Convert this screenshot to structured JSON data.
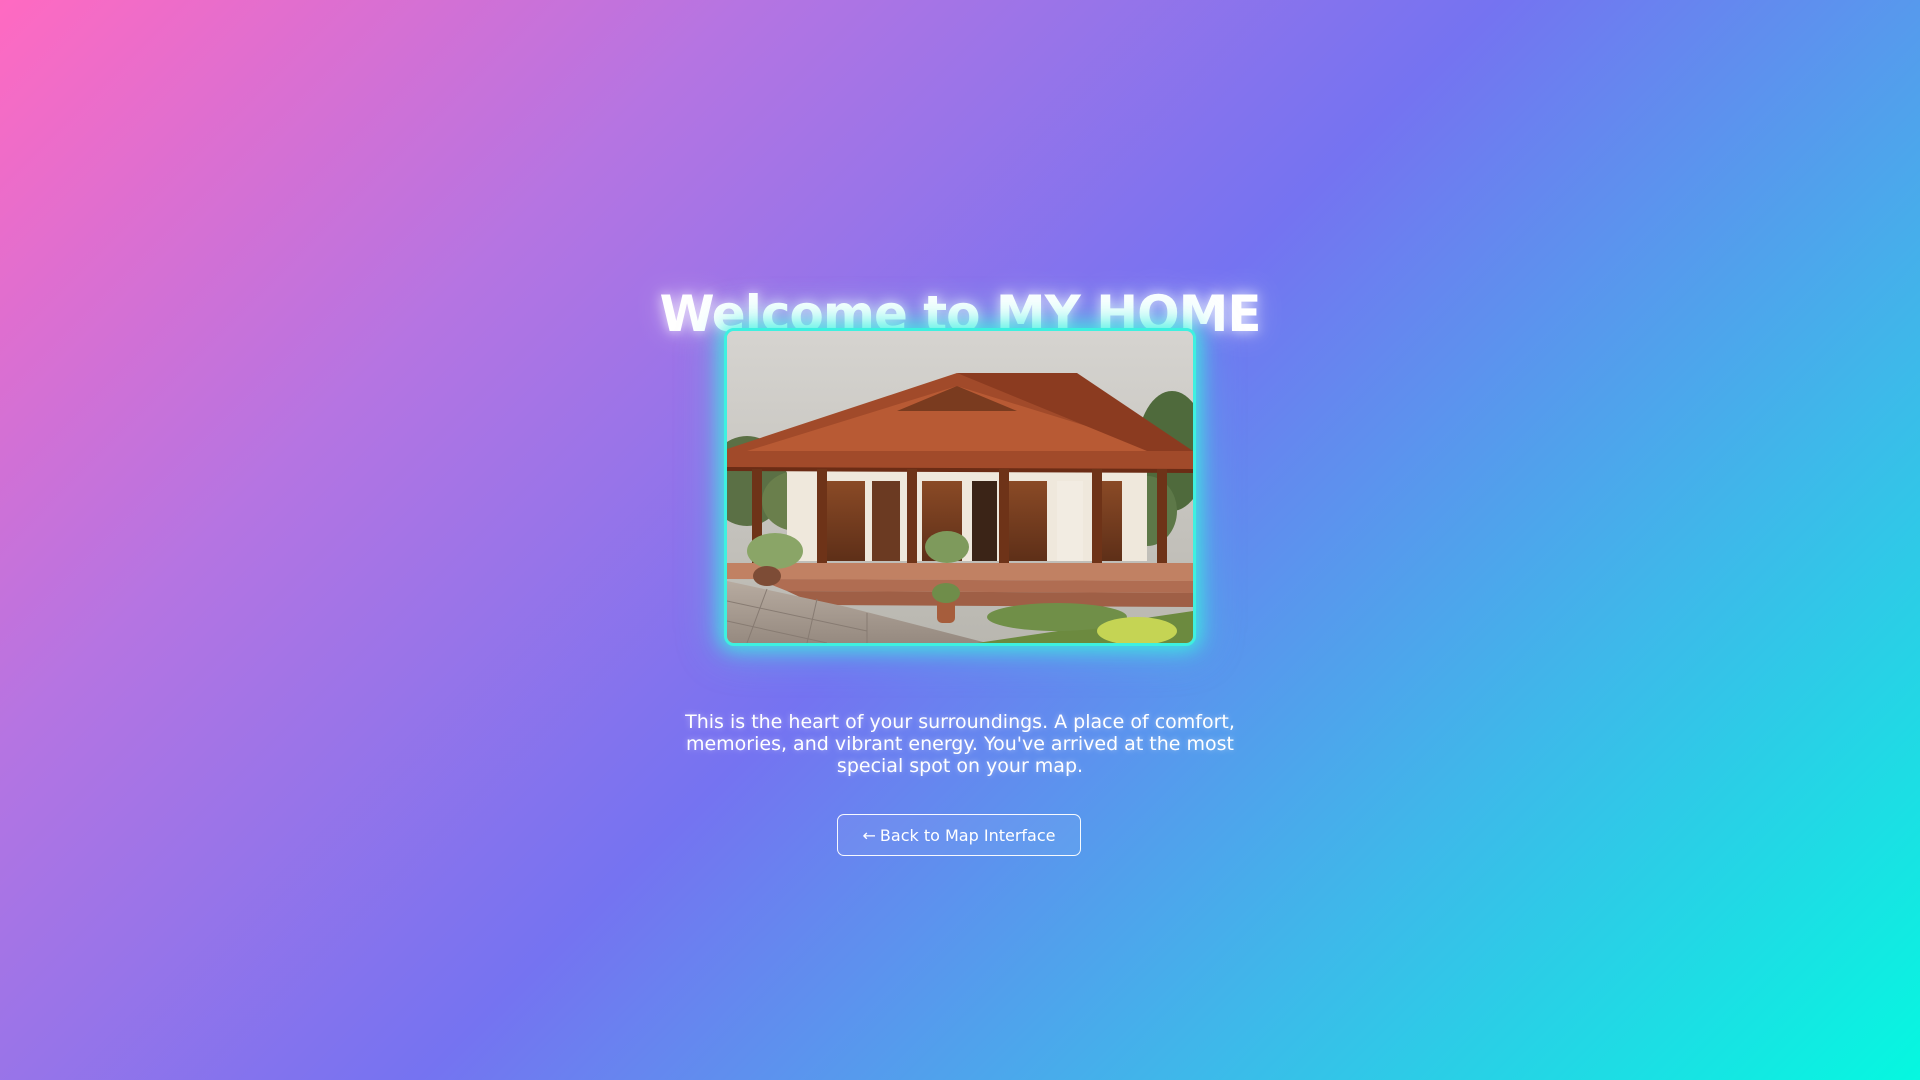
{
  "page": {
    "title": "Welcome to MY HOME",
    "description": "This is the heart of your surroundings. A place of comfort, memories, and vibrant energy. You've arrived at the most special spot on your map.",
    "back_button": {
      "arrow_icon": "arrow-left-icon",
      "arrow_glyph": "←",
      "label": "Back to Map Interface"
    },
    "image": {
      "alt": "House"
    }
  },
  "colors": {
    "background_gradient": [
      "#ff6ac1",
      "#b574e2",
      "#7573f1",
      "#3fb7ea",
      "#05f8e0"
    ],
    "image_glow": "#3ef0e0",
    "text": "#ffffff"
  }
}
